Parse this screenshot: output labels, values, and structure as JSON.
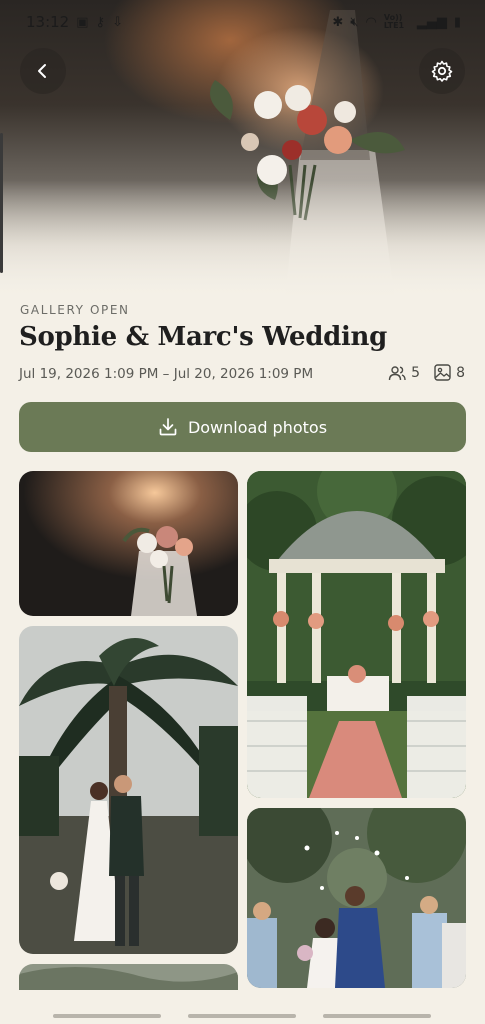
{
  "status_bar": {
    "time": "13:12",
    "network_label": "Vo)) LTE1"
  },
  "gallery": {
    "status_label": "GALLERY OPEN",
    "title": "Sophie & Marc's Wedding",
    "date_range": "Jul 19, 2026 1:09 PM – Jul 20, 2026 1:09 PM",
    "guest_count": "5",
    "photo_count": "8"
  },
  "actions": {
    "download_label": "Download photos"
  },
  "icons": {
    "back": "back-arrow-icon",
    "settings": "gear-icon",
    "guests": "people-icon",
    "photos": "image-icon",
    "download": "download-icon"
  },
  "colors": {
    "background": "#f4f0e7",
    "accent": "#6b7a56",
    "title": "#1f1f1f"
  }
}
